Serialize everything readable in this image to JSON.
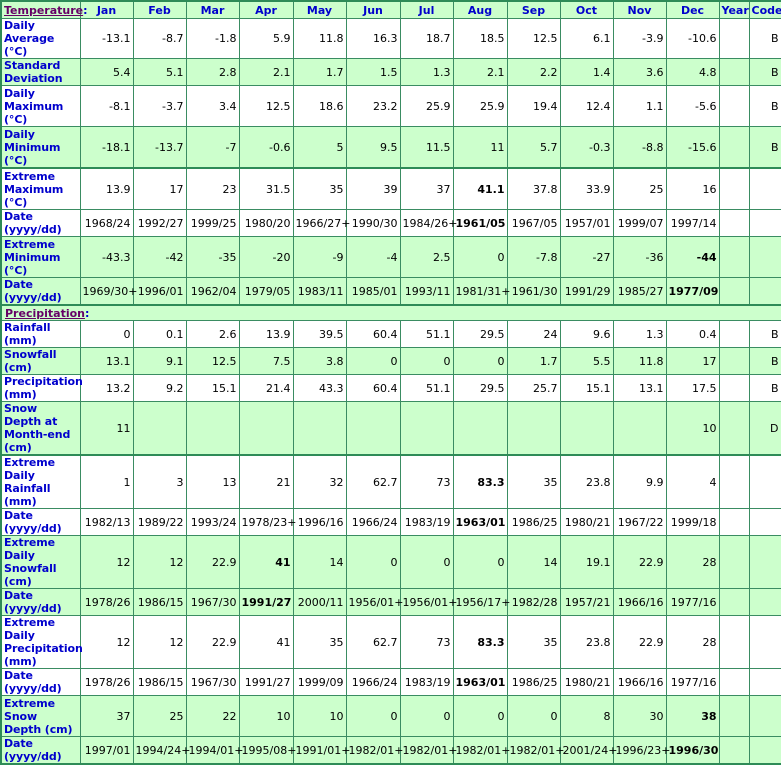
{
  "header": {
    "temperature_section": "Temperature",
    "months": [
      "Jan",
      "Feb",
      "Mar",
      "Apr",
      "May",
      "Jun",
      "Jul",
      "Aug",
      "Sep",
      "Oct",
      "Nov",
      "Dec"
    ],
    "year": "Year",
    "code": "Code"
  },
  "colors": {
    "header_bg": "#ccffcc",
    "label_text": "#0000cc",
    "section_link": "#660066",
    "border": "#2e8b57",
    "alt_row": "#ccffcc"
  },
  "temperature": {
    "rows": [
      {
        "label": "Daily Average (°C)",
        "values": [
          "-13.1",
          "-8.7",
          "-1.8",
          "5.9",
          "11.8",
          "16.3",
          "18.7",
          "18.5",
          "12.5",
          "6.1",
          "-3.9",
          "-10.6"
        ],
        "year": "",
        "code": "B"
      },
      {
        "label": "Standard Deviation",
        "values": [
          "5.4",
          "5.1",
          "2.8",
          "2.1",
          "1.7",
          "1.5",
          "1.3",
          "2.1",
          "2.2",
          "1.4",
          "3.6",
          "4.8"
        ],
        "year": "",
        "code": "B"
      },
      {
        "label": "Daily Maximum (°C)",
        "values": [
          "-8.1",
          "-3.7",
          "3.4",
          "12.5",
          "18.6",
          "23.2",
          "25.9",
          "25.9",
          "19.4",
          "12.4",
          "1.1",
          "-5.6"
        ],
        "year": "",
        "code": "B"
      },
      {
        "label": "Daily Minimum (°C)",
        "values": [
          "-18.1",
          "-13.7",
          "-7",
          "-0.6",
          "5",
          "9.5",
          "11.5",
          "11",
          "5.7",
          "-0.3",
          "-8.8",
          "-15.6"
        ],
        "year": "",
        "code": "B"
      },
      {
        "label": "Extreme Maximum (°C)",
        "values": [
          "13.9",
          "17",
          "23",
          "31.5",
          "35",
          "39",
          "37",
          "41.1",
          "37.8",
          "33.9",
          "25",
          "16"
        ],
        "bold_index": 7,
        "year": "",
        "code": ""
      },
      {
        "label": "Date (yyyy/dd)",
        "values": [
          "1968/24",
          "1992/27",
          "1999/25",
          "1980/20",
          "1966/27+",
          "1990/30",
          "1984/26+",
          "1961/05",
          "1967/05",
          "1957/01",
          "1999/07",
          "1997/14"
        ],
        "bold_index": 7,
        "year": "",
        "code": ""
      },
      {
        "label": "Extreme Minimum (°C)",
        "values": [
          "-43.3",
          "-42",
          "-35",
          "-20",
          "-9",
          "-4",
          "2.5",
          "0",
          "-7.8",
          "-27",
          "-36",
          "-44"
        ],
        "bold_index": 11,
        "year": "",
        "code": ""
      },
      {
        "label": "Date (yyyy/dd)",
        "values": [
          "1969/30+",
          "1996/01",
          "1962/04",
          "1979/05",
          "1983/11",
          "1985/01",
          "1993/11",
          "1981/31+",
          "1961/30",
          "1991/29",
          "1985/27",
          "1977/09"
        ],
        "bold_index": 11,
        "year": "",
        "code": ""
      }
    ]
  },
  "precipitation": {
    "section_label": "Precipitation",
    "rows": [
      {
        "label": "Rainfall (mm)",
        "values": [
          "0",
          "0.1",
          "2.6",
          "13.9",
          "39.5",
          "60.4",
          "51.1",
          "29.5",
          "24",
          "9.6",
          "1.3",
          "0.4"
        ],
        "year": "",
        "code": "B"
      },
      {
        "label": "Snowfall (cm)",
        "values": [
          "13.1",
          "9.1",
          "12.5",
          "7.5",
          "3.8",
          "0",
          "0",
          "0",
          "1.7",
          "5.5",
          "11.8",
          "17"
        ],
        "year": "",
        "code": "B"
      },
      {
        "label": "Precipitation (mm)",
        "values": [
          "13.2",
          "9.2",
          "15.1",
          "21.4",
          "43.3",
          "60.4",
          "51.1",
          "29.5",
          "25.7",
          "15.1",
          "13.1",
          "17.5"
        ],
        "year": "",
        "code": "B"
      },
      {
        "label": "Snow Depth at Month-end (cm)",
        "values": [
          "11",
          "",
          "",
          "",
          "",
          "",
          "",
          "",
          "",
          "",
          "",
          "10"
        ],
        "year": "",
        "code": "D"
      },
      {
        "label": "Extreme Daily Rainfall (mm)",
        "values": [
          "1",
          "3",
          "13",
          "21",
          "32",
          "62.7",
          "73",
          "83.3",
          "35",
          "23.8",
          "9.9",
          "4"
        ],
        "bold_index": 7,
        "year": "",
        "code": ""
      },
      {
        "label": "Date (yyyy/dd)",
        "values": [
          "1982/13",
          "1989/22",
          "1993/24",
          "1978/23+",
          "1996/16",
          "1966/24",
          "1983/19",
          "1963/01",
          "1986/25",
          "1980/21",
          "1967/22",
          "1999/18"
        ],
        "bold_index": 7,
        "year": "",
        "code": ""
      },
      {
        "label": "Extreme Daily Snowfall (cm)",
        "values": [
          "12",
          "12",
          "22.9",
          "41",
          "14",
          "0",
          "0",
          "0",
          "14",
          "19.1",
          "22.9",
          "28"
        ],
        "bold_index": 3,
        "year": "",
        "code": ""
      },
      {
        "label": "Date (yyyy/dd)",
        "values": [
          "1978/26",
          "1986/15",
          "1967/30",
          "1991/27",
          "2000/11",
          "1956/01+",
          "1956/01+",
          "1956/17+",
          "1982/28",
          "1957/21",
          "1966/16",
          "1977/16"
        ],
        "bold_index": 3,
        "year": "",
        "code": ""
      },
      {
        "label": "Extreme Daily Precipitation (mm)",
        "values": [
          "12",
          "12",
          "22.9",
          "41",
          "35",
          "62.7",
          "73",
          "83.3",
          "35",
          "23.8",
          "22.9",
          "28"
        ],
        "bold_index": 7,
        "year": "",
        "code": ""
      },
      {
        "label": "Date (yyyy/dd)",
        "values": [
          "1978/26",
          "1986/15",
          "1967/30",
          "1991/27",
          "1999/09",
          "1966/24",
          "1983/19",
          "1963/01",
          "1986/25",
          "1980/21",
          "1966/16",
          "1977/16"
        ],
        "bold_index": 7,
        "year": "",
        "code": ""
      },
      {
        "label": "Extreme Snow Depth (cm)",
        "values": [
          "37",
          "25",
          "22",
          "10",
          "10",
          "0",
          "0",
          "0",
          "0",
          "8",
          "30",
          "38"
        ],
        "bold_index": 11,
        "year": "",
        "code": ""
      },
      {
        "label": "Date (yyyy/dd)",
        "values": [
          "1997/01",
          "1994/24+",
          "1994/01+",
          "1995/08+",
          "1991/01+",
          "1982/01+",
          "1982/01+",
          "1982/01+",
          "1982/01+",
          "2001/24+",
          "1996/23+",
          "1996/30"
        ],
        "bold_index": 11,
        "year": "",
        "code": ""
      }
    ]
  }
}
